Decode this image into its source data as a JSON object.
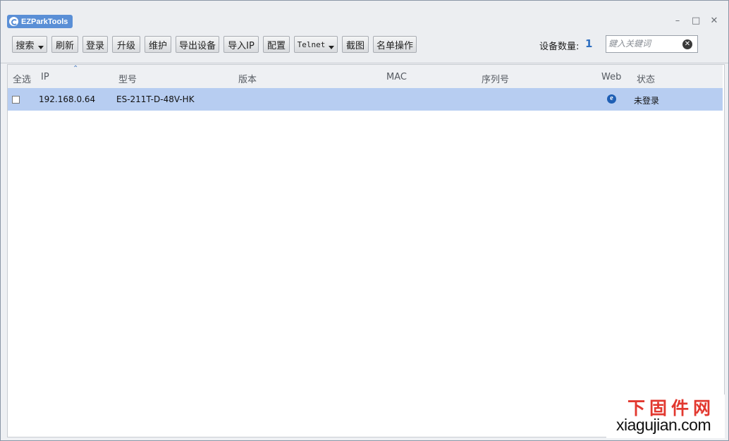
{
  "app": {
    "title": "EZParkTools"
  },
  "window_controls": {
    "minimize": "–",
    "maximize": "□",
    "close": "✕"
  },
  "toolbar": {
    "buttons": [
      {
        "label": "搜索",
        "dropdown": true
      },
      {
        "label": "刷新"
      },
      {
        "label": "登录"
      },
      {
        "label": "升级"
      },
      {
        "label": "维护"
      },
      {
        "label": "导出设备"
      },
      {
        "label": "导入IP"
      },
      {
        "label": "配置"
      },
      {
        "label": "Telnet",
        "dropdown": true
      },
      {
        "label": "截图"
      },
      {
        "label": "名单操作"
      }
    ],
    "device_count_label": "设备数量:",
    "device_count": "1",
    "search_placeholder": "鍵入关鍵词"
  },
  "table": {
    "columns": [
      "全选",
      "IP",
      "型号",
      "版本",
      "MAC",
      "序列号",
      "Web",
      "状态"
    ],
    "rows": [
      {
        "checked": false,
        "ip": "192.168.0.64",
        "model": "ES-211T-D-48V-HK",
        "version": "",
        "mac": "",
        "serial": "",
        "web_icon": "ie-icon",
        "status": "未登录"
      }
    ]
  },
  "watermark": {
    "cn": "下固件网",
    "en": "xiagujian.com"
  },
  "colors": {
    "accent": "#2f6fc0",
    "selected_row": "#b7cdf1",
    "badge": "#5a8fd6",
    "watermark_red": "#e2382f"
  }
}
